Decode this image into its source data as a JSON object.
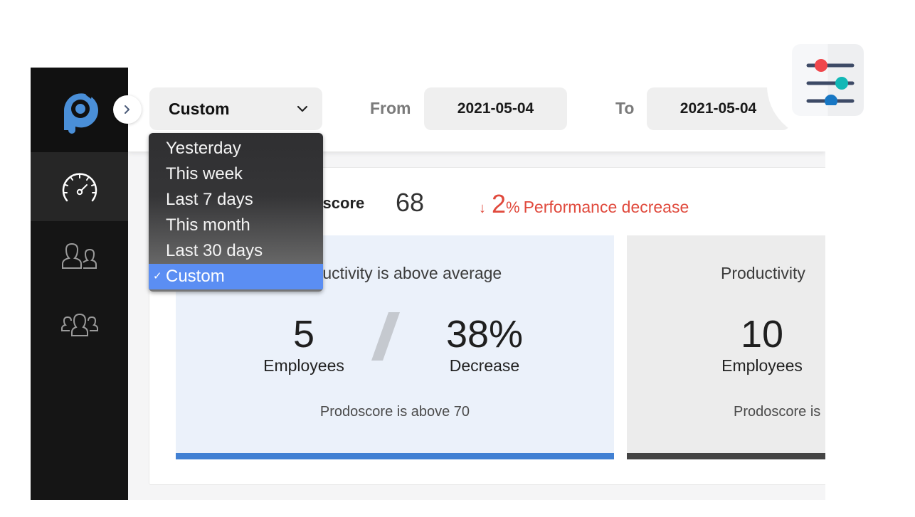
{
  "sidebar": {
    "logo": "prodoscore-logo",
    "items": [
      {
        "name": "dashboard",
        "icon": "speedometer-icon",
        "active": true
      },
      {
        "name": "team",
        "icon": "users-icon",
        "active": false
      },
      {
        "name": "groups",
        "icon": "group-icon",
        "active": false
      }
    ]
  },
  "header": {
    "expand_icon": "chevron-right-icon",
    "period": {
      "value": "Custom",
      "icon": "chevron-down-icon"
    },
    "from_label": "From",
    "from_value": "2021-05-04",
    "to_label": "To",
    "to_value": "2021-05-04",
    "filter_icon": "sliders-icon",
    "filter_colors": [
      "#f0474c",
      "#12b8b6",
      "#1877c4"
    ]
  },
  "dropdown": {
    "options": [
      {
        "label": "Yesterday",
        "selected": false
      },
      {
        "label": "This week",
        "selected": false
      },
      {
        "label": "Last 7 days",
        "selected": false
      },
      {
        "label": "This month",
        "selected": false
      },
      {
        "label": "Last 30 days",
        "selected": false
      },
      {
        "label": "Custom",
        "selected": true
      }
    ],
    "check": "✓"
  },
  "summary": {
    "score_label": "Prodoscore",
    "score_value": "68",
    "trend_arrow": "↓",
    "trend_num": "2",
    "trend_pct": "%",
    "trend_text": "Performance decrease",
    "trend_color": "#e0493c"
  },
  "panels": [
    {
      "title": "Productivity is above average",
      "employees": "5",
      "employees_label": "Employees",
      "change": "38%",
      "change_label": "Decrease",
      "footer": "Prodoscore is above 70",
      "accent": "#4180d3"
    },
    {
      "title": "Productivity",
      "employees": "10",
      "employees_label": "Employees",
      "footer": "Prodoscore is",
      "accent": "#444444"
    }
  ]
}
